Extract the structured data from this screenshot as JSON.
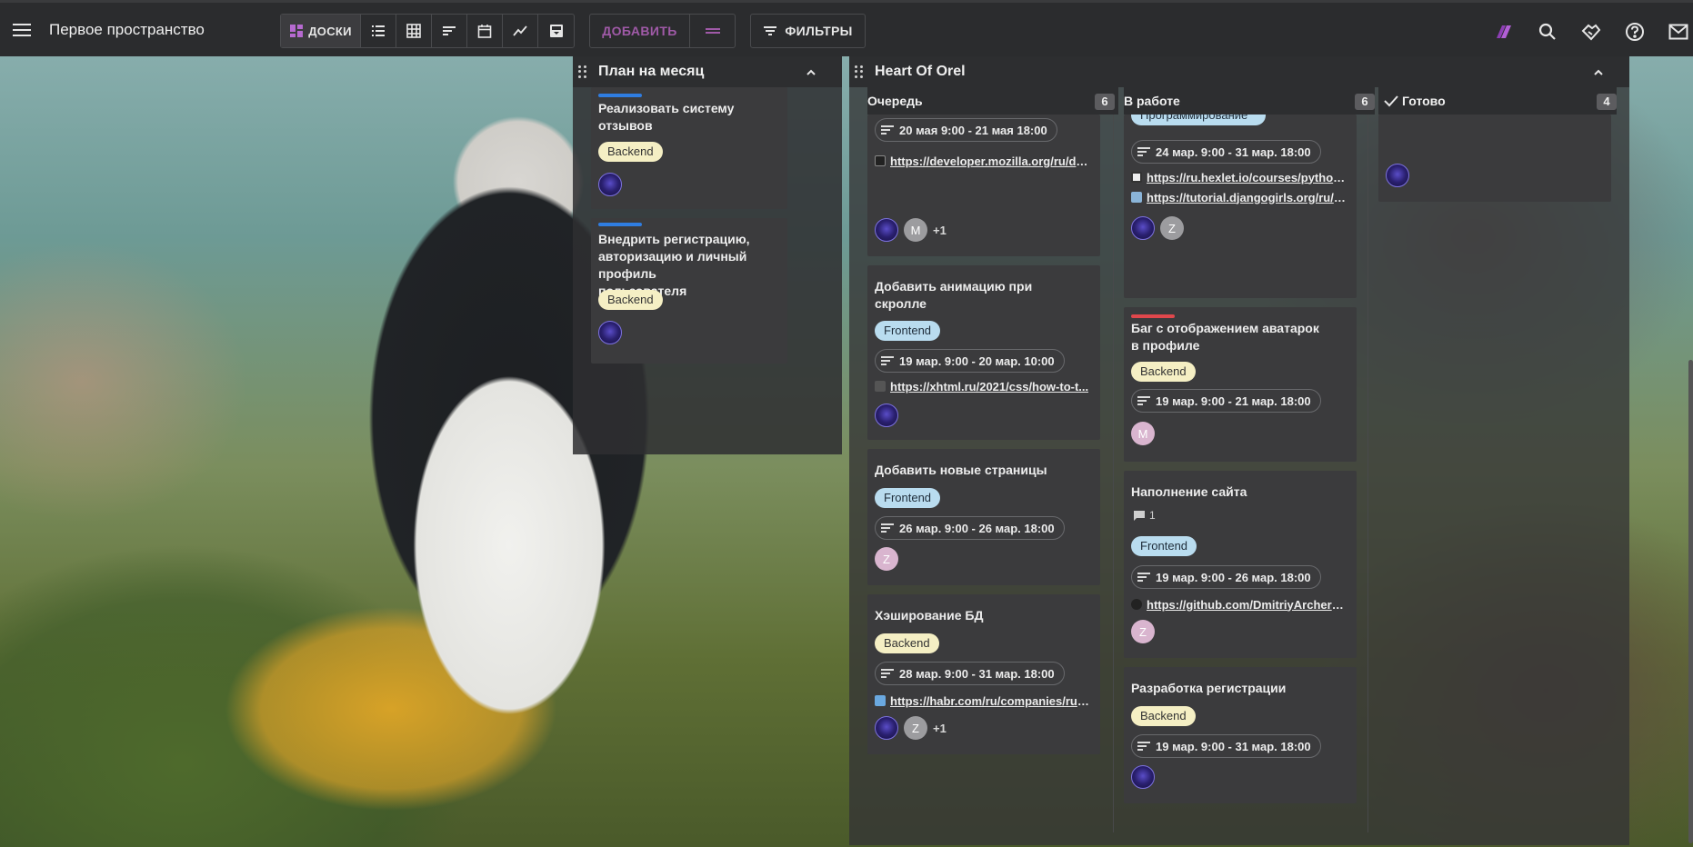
{
  "topbar": {
    "workspace_title": "Первое пространство",
    "view_boards_label": "ДОСКИ",
    "add_label": "ДОБАВИТЬ",
    "filters_label": "ФИЛЬТРЫ",
    "accent": "#a05aa8"
  },
  "panels": [
    {
      "title": "План на месяц"
    },
    {
      "title": "Heart Of Orel"
    }
  ],
  "plan": {
    "cards": [
      {
        "title_l1": "Реализовать систему",
        "title_l2": "отзывов",
        "tag": "Backend"
      },
      {
        "title_l1": "Внедрить регистрацию,",
        "title_l2": "авторизацию и личный профиль",
        "title_l3": "пользователя",
        "tag": "Backend"
      }
    ]
  },
  "columns": [
    {
      "name": "Очередь",
      "count": "6"
    },
    {
      "name": "В работе",
      "count": "6"
    },
    {
      "name": "Готово",
      "count": "4"
    }
  ],
  "queue": {
    "cards": [
      {
        "date": "20 мая 9:00 - 21 мая 18:00",
        "link": "https://developer.mozilla.org/ru/do...",
        "more": "+1",
        "avatar2": "M"
      },
      {
        "title_l1": "Добавить анимацию при",
        "title_l2": "скролле",
        "tag": "Frontend",
        "date": "19 мар. 9:00 - 20 мар. 10:00",
        "link": "https://xhtml.ru/2021/css/how-to-t..."
      },
      {
        "title": "Добавить новые страницы",
        "tag": "Frontend",
        "date": "26 мар. 9:00 - 26 мар. 18:00",
        "avatar": "Z"
      },
      {
        "title": "Хэширование БД",
        "tag": "Backend",
        "date": "28 мар. 9:00 - 31 мар. 18:00",
        "link": "https://habr.com/ru/companies/ruv...",
        "avatar2": "Z",
        "more": "+1"
      }
    ]
  },
  "work": {
    "cards": [
      {
        "tag_partial": "Программирование",
        "date": "24 мар. 9:00 - 31 мар. 18:00",
        "link1": "https://ru.hexlet.io/courses/python-...",
        "link2": "https://tutorial.djangogirls.org/ru/dj...",
        "avatar2": "Z"
      },
      {
        "title_l1": "Баг с отображением аватарок",
        "title_l2": "в профиле",
        "tag": "Backend",
        "date": "19 мар. 9:00 - 21 мар. 18:00",
        "avatar": "M",
        "stripe": "#e0474c"
      },
      {
        "title": "Наполнение сайта",
        "comments": "1",
        "tag": "Frontend",
        "date": "19 мар. 9:00 - 26 мар. 18:00",
        "link": "https://github.com/DmitriyArcher1/...",
        "avatar": "Z"
      },
      {
        "title": "Разработка регистрации",
        "tag": "Backend",
        "date": "19 мар. 9:00 - 31 мар. 18:00"
      }
    ]
  },
  "colors": {
    "blue_stripe": "#2f7de1",
    "red_stripe": "#e0474c"
  }
}
